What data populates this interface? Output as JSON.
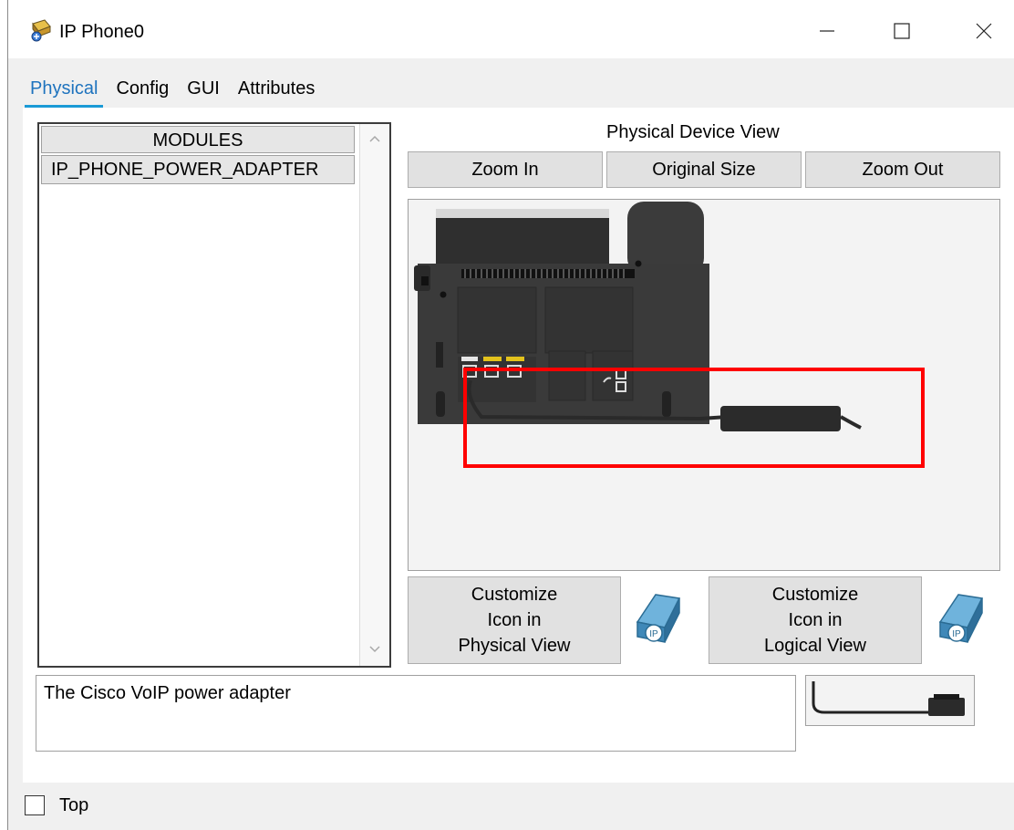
{
  "window": {
    "title": "IP Phone0",
    "icon": "device-icon",
    "controls": [
      "minimize-icon",
      "maximize-icon",
      "close-icon"
    ]
  },
  "tabs": [
    {
      "label": "Physical",
      "active": true
    },
    {
      "label": "Config",
      "active": false
    },
    {
      "label": "GUI",
      "active": false
    },
    {
      "label": "Attributes",
      "active": false
    }
  ],
  "modules": {
    "header": "MODULES",
    "items": [
      "IP_PHONE_POWER_ADAPTER"
    ]
  },
  "physical_view": {
    "title": "Physical Device View",
    "zoom_in": "Zoom In",
    "original_size": "Original Size",
    "zoom_out": "Zoom Out",
    "highlight_color": "#ff0000"
  },
  "customize": {
    "physical": "Customize\nIcon in\nPhysical View",
    "logical": "Customize\nIcon in\nLogical View"
  },
  "description": "The Cisco VoIP power adapter",
  "bottom": {
    "checkbox_label": "Top",
    "checked": false
  }
}
